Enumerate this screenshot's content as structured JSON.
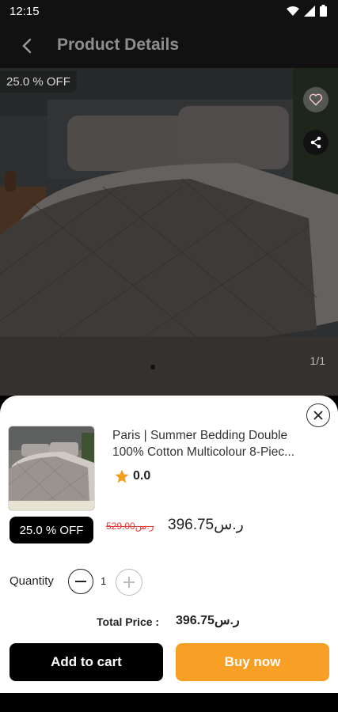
{
  "status_bar": {
    "time": "12:15"
  },
  "app_bar": {
    "title": "Product Details"
  },
  "hero": {
    "discount_badge": "25.0 % OFF",
    "image_counter": "1/1"
  },
  "product": {
    "title_line1": "Paris | Summer Bedding Double",
    "title_line2": "100% Cotton Multicolour 8-Piec...",
    "rating": "0.0",
    "discount_badge": "25.0 % OFF",
    "old_price": "529.00ر.س",
    "new_price": "396.75ر.س"
  },
  "quantity": {
    "label": "Quantity",
    "value": "1"
  },
  "total": {
    "label": "Total Price :",
    "value": "396.75ر.س"
  },
  "actions": {
    "add_to_cart": "Add to cart",
    "buy_now": "Buy now"
  },
  "colors": {
    "accent": "#f8a025",
    "primary": "#000000",
    "discount_red": "#e53935",
    "star": "#f29d1b"
  }
}
